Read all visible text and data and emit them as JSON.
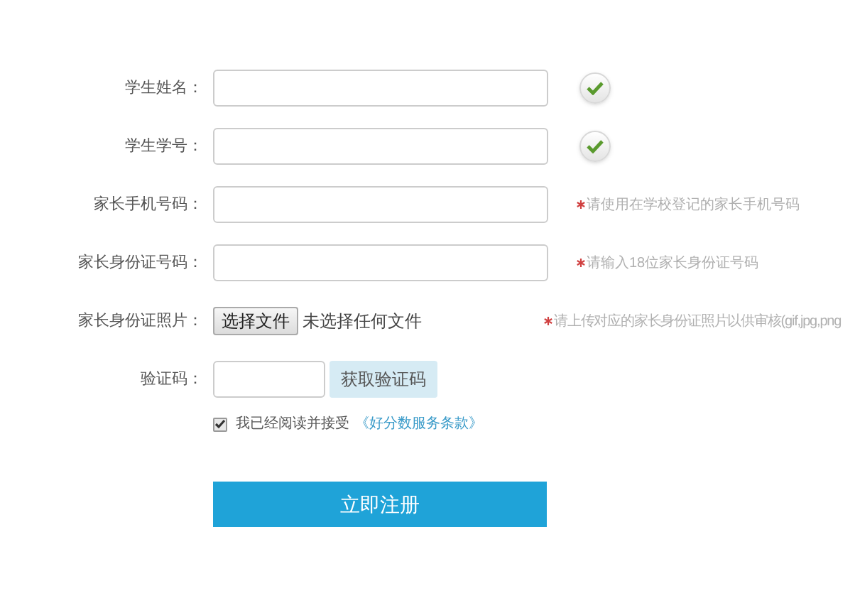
{
  "fields": [
    {
      "kind": "text",
      "label": "学生姓名：",
      "valid": true
    },
    {
      "kind": "text",
      "label": "学生学号：",
      "valid": true
    },
    {
      "kind": "text",
      "label": "家长手机号码：",
      "valid": false,
      "hint": "请使用在学校登记的家长手机号码"
    },
    {
      "kind": "text",
      "label": "家长身份证号码：",
      "valid": false,
      "hint": "请输入18位家长身份证号码"
    },
    {
      "kind": "file",
      "label": "家长身份证照片：",
      "button": "选择文件",
      "status": "未选择任何文件",
      "valid": false,
      "hint": "请上传对应的家长身份证照片以供审核(gif,jpg,png"
    },
    {
      "kind": "captcha",
      "label": "验证码：",
      "button": "获取验证码"
    }
  ],
  "agreement": {
    "checked": true,
    "text": "我已经阅读并接受",
    "link": "《好分数服务条款》"
  },
  "submit": "立即注册"
}
